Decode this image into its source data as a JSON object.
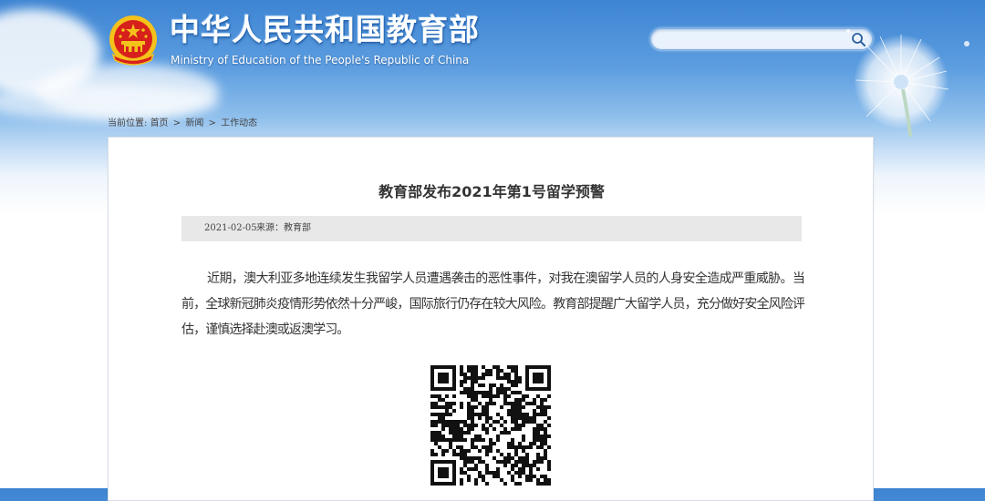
{
  "site": {
    "title": "中华人民共和国教育部",
    "subtitle": "Ministry of Education of the People's Republic of China"
  },
  "search": {
    "placeholder": ""
  },
  "breadcrumb": {
    "prefix": "当前位置:",
    "items": [
      "首页",
      "新闻",
      "工作动态"
    ],
    "separator": ">"
  },
  "article": {
    "title": "教育部发布2021年第1号留学预警",
    "date": "2021-02-05",
    "source": "来源：教育部",
    "body": "近期，澳大利亚多地连续发生我留学人员遭遇袭击的恶性事件，对我在澳留学人员的人身安全造成严重威胁。当前，全球新冠肺炎疫情形势依然十分严峻，国际旅行仍存在较大风险。教育部提醒广大留学人员，充分做好安全风险评估，谨慎选择赴澳或返澳学习。"
  },
  "colors": {
    "sky": "#3d84d2",
    "emblem_red": "#d7201c",
    "emblem_gold": "#f4c21b",
    "meta_bar": "#e8e8e8",
    "text": "#333333"
  },
  "icons": {
    "emblem": "national-emblem-icon",
    "search": "search-icon",
    "decoration": "dandelion-icon",
    "qr": "qr-code"
  }
}
